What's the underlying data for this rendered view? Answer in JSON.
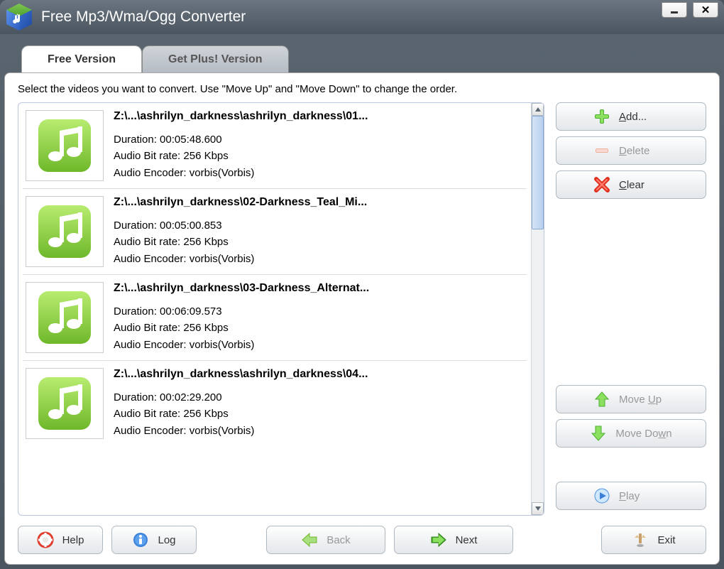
{
  "app": {
    "title": "Free Mp3/Wma/Ogg Converter"
  },
  "tabs": {
    "free": "Free Version",
    "plus": "Get Plus! Version"
  },
  "instruction": "Select the videos you want to convert. Use \"Move Up\" and \"Move Down\" to change the order.",
  "items": [
    {
      "title": "Z:\\...\\ashrilyn_darkness\\ashrilyn_darkness\\01...",
      "duration": "Duration: 00:05:48.600",
      "bitrate": "Audio Bit rate: 256 Kbps",
      "encoder": "Audio Encoder: vorbis(Vorbis)"
    },
    {
      "title": "Z:\\...\\ashrilyn_darkness\\02-Darkness_Teal_Mi...",
      "duration": "Duration: 00:05:00.853",
      "bitrate": "Audio Bit rate: 256 Kbps",
      "encoder": "Audio Encoder: vorbis(Vorbis)"
    },
    {
      "title": "Z:\\...\\ashrilyn_darkness\\03-Darkness_Alternat...",
      "duration": "Duration: 00:06:09.573",
      "bitrate": "Audio Bit rate: 256 Kbps",
      "encoder": "Audio Encoder: vorbis(Vorbis)"
    },
    {
      "title": "Z:\\...\\ashrilyn_darkness\\ashrilyn_darkness\\04...",
      "duration": "Duration: 00:02:29.200",
      "bitrate": "Audio Bit rate: 256 Kbps",
      "encoder": "Audio Encoder: vorbis(Vorbis)"
    }
  ],
  "buttons": {
    "add": "Add...",
    "delete": "Delete",
    "clear": "Clear",
    "moveup": "Move Up",
    "movedown": "Move Down",
    "play": "Play",
    "help": "Help",
    "log": "Log",
    "back": "Back",
    "next": "Next",
    "exit": "Exit"
  }
}
